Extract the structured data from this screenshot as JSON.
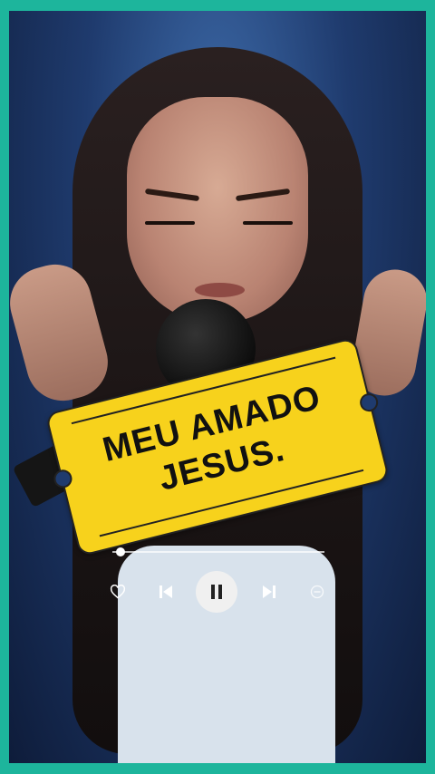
{
  "overlay": {
    "line1": "MEU  AMADO",
    "line2": "JESUS."
  },
  "player": {
    "progress": 0.04,
    "icons": [
      "heart-icon",
      "previous-icon",
      "pause-icon",
      "next-icon",
      "minus-circle-icon"
    ]
  },
  "colors": {
    "border": "#1db59c",
    "sticker": "#f7d21c"
  }
}
